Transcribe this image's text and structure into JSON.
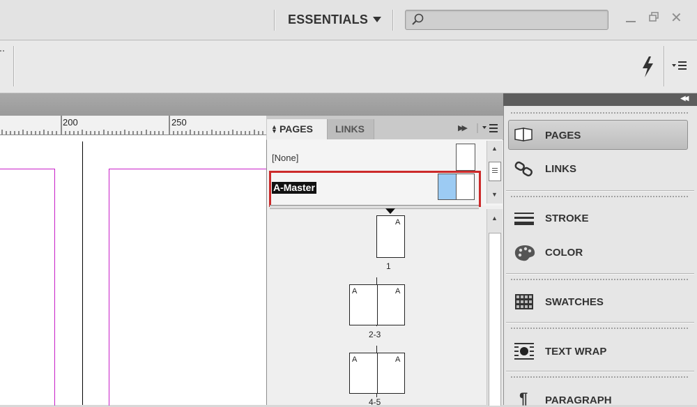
{
  "titlebar": {
    "workspace": "ESSENTIALS",
    "search_placeholder": ""
  },
  "ruler": {
    "labels": [
      "200",
      "250"
    ]
  },
  "pages_panel": {
    "tabs": [
      {
        "label": "PAGES",
        "active": true
      },
      {
        "label": "LINKS",
        "active": false
      }
    ],
    "masters": [
      {
        "label": "[None]"
      },
      {
        "label": "A-Master",
        "selected": true
      }
    ],
    "pages": [
      {
        "number": "1",
        "prefix": "A"
      },
      {
        "number": "2-3",
        "prefix": "A"
      },
      {
        "number": "4-5",
        "prefix": "A"
      }
    ]
  },
  "dock": {
    "items": [
      {
        "label": "PAGES",
        "icon": "pages-icon",
        "selected": true
      },
      {
        "label": "LINKS",
        "icon": "links-icon"
      },
      {
        "label": "STROKE",
        "icon": "stroke-icon"
      },
      {
        "label": "COLOR",
        "icon": "color-palette-icon"
      },
      {
        "label": "SWATCHES",
        "icon": "swatches-icon"
      },
      {
        "label": "TEXT WRAP",
        "icon": "text-wrap-icon"
      },
      {
        "label": "PARAGRAPH",
        "icon": "paragraph-icon"
      }
    ]
  },
  "colors": {
    "master_highlight_border": "#cc2a2a",
    "margin_guide": "#c81ec8",
    "master_thumb_fill": "#9ccbf3"
  }
}
